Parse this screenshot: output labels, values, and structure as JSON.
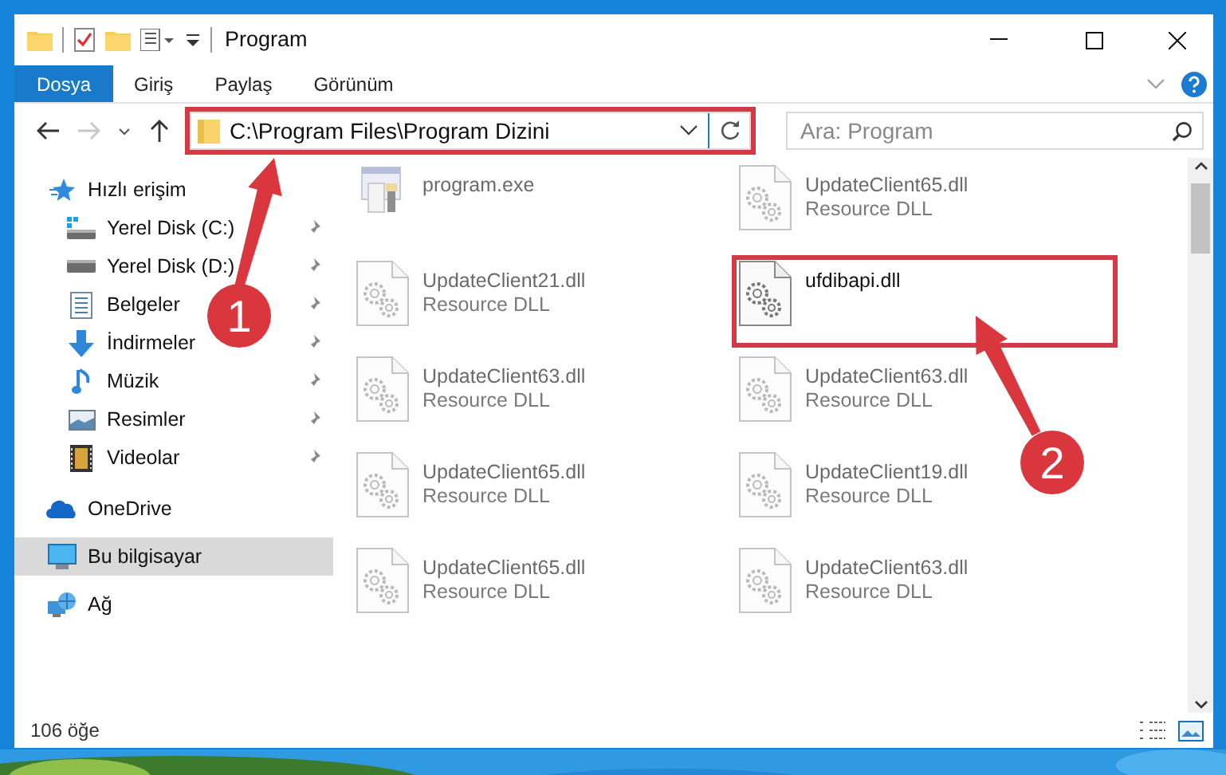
{
  "window": {
    "title": "Program"
  },
  "ribbon_tabs": [
    {
      "label": "Dosya",
      "selected": true
    },
    {
      "label": "Giriş",
      "selected": false
    },
    {
      "label": "Paylaş",
      "selected": false
    },
    {
      "label": "Görünüm",
      "selected": false
    }
  ],
  "address": {
    "path": "C:\\Program Files\\Program Dizini",
    "highlighted": true
  },
  "search": {
    "placeholder": "Ara: Program"
  },
  "sidebar": {
    "items": [
      {
        "label": "Hızlı erişim",
        "kind": "quick",
        "selected": false,
        "children": [
          {
            "label": "Yerel Disk (C:)",
            "kind": "system-drive",
            "selected": false,
            "pinned": true
          },
          {
            "label": "Yerel Disk (D:)",
            "kind": "drive",
            "selected": false,
            "pinned": true
          },
          {
            "label": "Belgeler",
            "kind": "documents",
            "selected": false,
            "pinned": true
          },
          {
            "label": "İndirmeler",
            "kind": "downloads",
            "selected": false,
            "pinned": true
          },
          {
            "label": "Müzik",
            "kind": "music",
            "selected": false,
            "pinned": true
          },
          {
            "label": "Resimler",
            "kind": "pictures",
            "selected": false,
            "pinned": true
          },
          {
            "label": "Videolar",
            "kind": "videos",
            "selected": false,
            "pinned": true
          }
        ]
      },
      {
        "label": "OneDrive",
        "kind": "cloud",
        "selected": false
      },
      {
        "label": "Bu bilgisayar",
        "kind": "computer",
        "selected": true
      },
      {
        "label": "Ağ",
        "kind": "network",
        "selected": false
      }
    ]
  },
  "files": [
    {
      "name": "program.exe",
      "kind": "exe",
      "faded": true,
      "highlighted": false
    },
    {
      "name": "UpdateClient65.dll",
      "type": "Resource DLL",
      "kind": "dll",
      "faded": true,
      "highlighted": false
    },
    {
      "name": "UpdateClient21.dll",
      "type": "Resource DLL",
      "kind": "dll",
      "faded": true,
      "highlighted": false
    },
    {
      "name": "ufdibapi.dll",
      "kind": "dll",
      "faded": false,
      "highlighted": true
    },
    {
      "name": "UpdateClient63.dll",
      "type": "Resource DLL",
      "kind": "dll",
      "faded": true,
      "highlighted": false
    },
    {
      "name": "UpdateClient63.dll",
      "type": "Resource DLL",
      "kind": "dll",
      "faded": true,
      "highlighted": false
    },
    {
      "name": "UpdateClient65.dll",
      "type": "Resource DLL",
      "kind": "dll",
      "faded": true,
      "highlighted": false
    },
    {
      "name": "UpdateClient19.dll",
      "type": "Resource DLL",
      "kind": "dll",
      "faded": true,
      "highlighted": false
    },
    {
      "name": "UpdateClient65.dll",
      "type": "Resource DLL",
      "kind": "dll",
      "faded": true,
      "highlighted": false
    },
    {
      "name": "UpdateClient63.dll",
      "type": "Resource DLL",
      "kind": "dll",
      "faded": true,
      "highlighted": false
    }
  ],
  "status_bar": {
    "count": "106 öğe"
  },
  "annotations": [
    {
      "number": "1"
    },
    {
      "number": "2"
    }
  ]
}
